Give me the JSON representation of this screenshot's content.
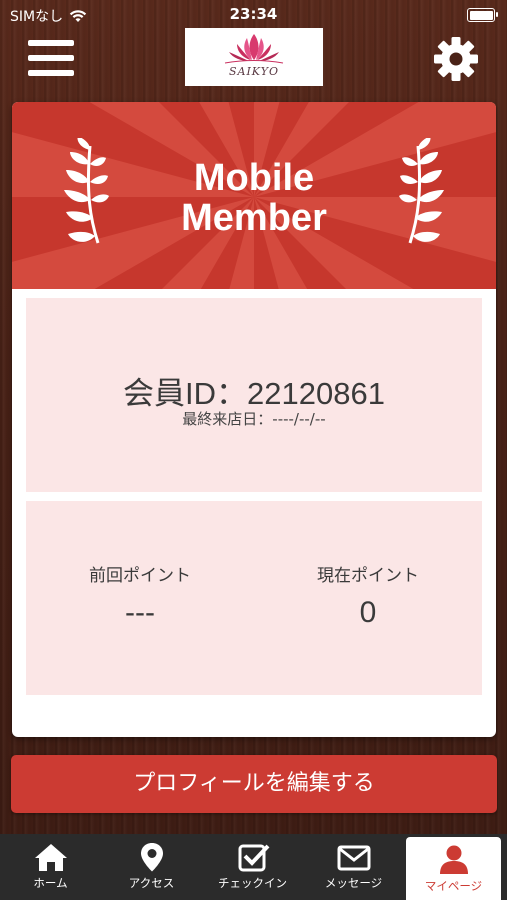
{
  "status_bar": {
    "carrier": "SIMなし",
    "time": "23:34"
  },
  "header": {
    "logo_text": "SAIKYO",
    "menu_icon": "hamburger-menu-icon",
    "settings_icon": "gear-icon"
  },
  "card": {
    "banner_title_line1": "Mobile",
    "banner_title_line2": "Member",
    "member_id": "会員ID：22120861",
    "last_visit": "最終来店日：----/--/--",
    "points": {
      "previous_label": "前回ポイント",
      "previous_value": "---",
      "current_label": "現在ポイント",
      "current_value": "0"
    }
  },
  "edit_profile_button": "プロフィールを編集する",
  "tabs": [
    {
      "label": "ホーム",
      "icon": "home-icon"
    },
    {
      "label": "アクセス",
      "icon": "map-pin-icon"
    },
    {
      "label": "チェックイン",
      "icon": "checkbox-icon"
    },
    {
      "label": "メッセージ",
      "icon": "mail-icon"
    },
    {
      "label": "マイページ",
      "icon": "user-icon",
      "active": true
    }
  ],
  "colors": {
    "accent": "#cc3b33",
    "panel": "#fbe6e6",
    "tabbar": "#2b2b2b"
  }
}
